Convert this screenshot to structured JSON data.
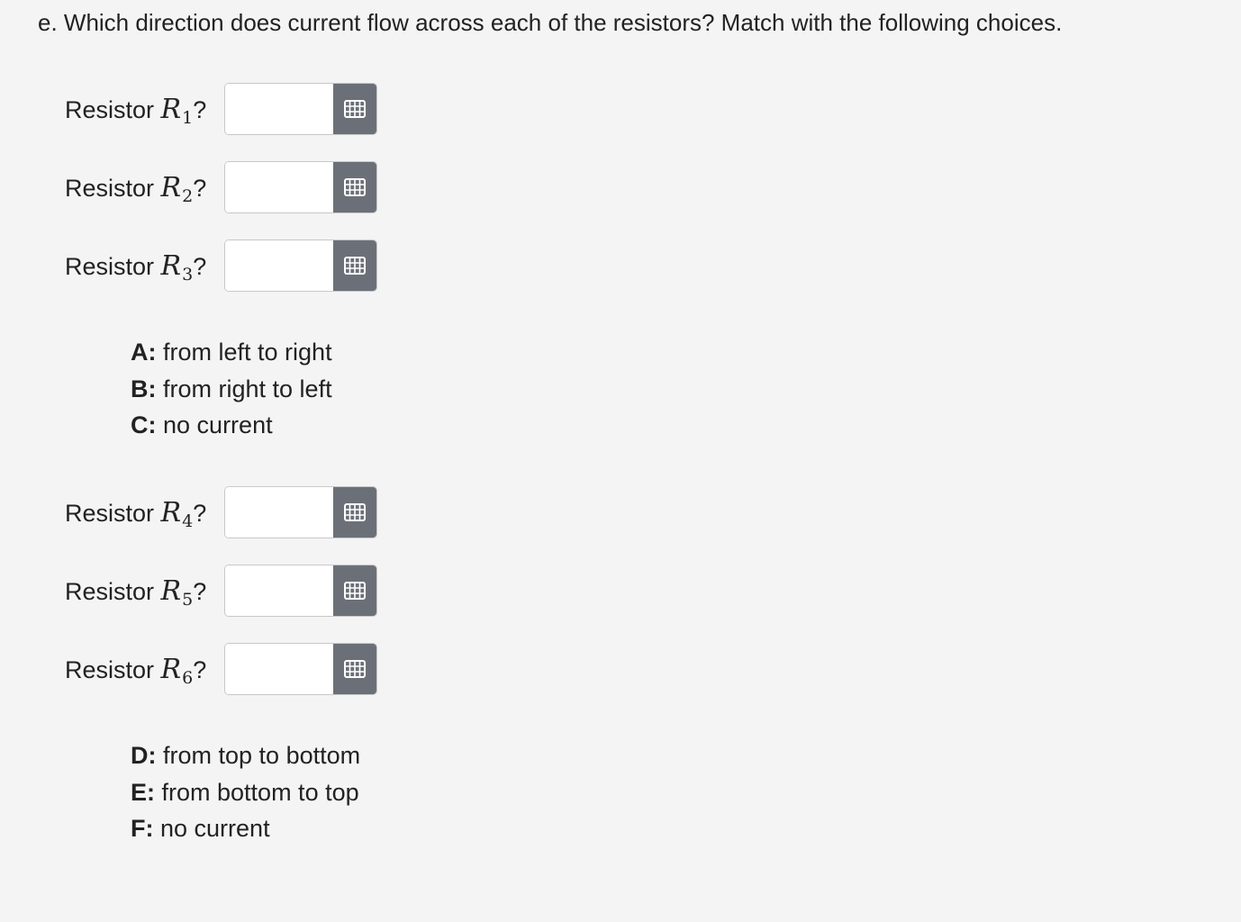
{
  "question": "e. Which direction does current flow across each of the resistors? Match with the following choices.",
  "resistor_prefix": "Resistor",
  "resistor_var": "R",
  "question_mark": "?",
  "icon": "grid-picker-icon",
  "group1": {
    "resistors": [
      {
        "sub": "1",
        "value": ""
      },
      {
        "sub": "2",
        "value": ""
      },
      {
        "sub": "3",
        "value": ""
      }
    ],
    "choices": [
      {
        "key": "A:",
        "text": "from left to right"
      },
      {
        "key": "B:",
        "text": "from right to left"
      },
      {
        "key": "C:",
        "text": "no current"
      }
    ]
  },
  "group2": {
    "resistors": [
      {
        "sub": "4",
        "value": ""
      },
      {
        "sub": "5",
        "value": ""
      },
      {
        "sub": "6",
        "value": ""
      }
    ],
    "choices": [
      {
        "key": "D:",
        "text": "from top to bottom"
      },
      {
        "key": "E:",
        "text": "from bottom to top"
      },
      {
        "key": "F:",
        "text": "no current"
      }
    ]
  }
}
